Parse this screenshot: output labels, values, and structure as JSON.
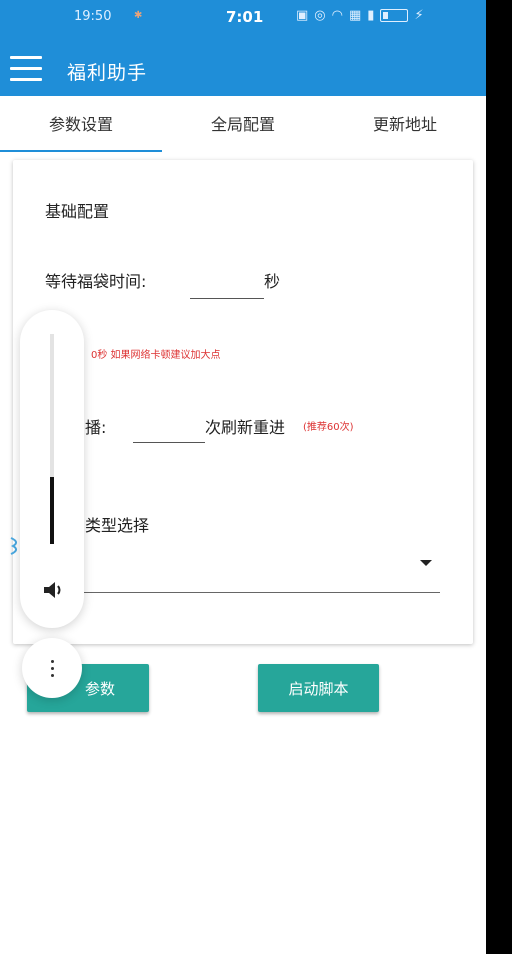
{
  "status_bar": {
    "time_left": "19:50",
    "time_center": "7:01",
    "icons": [
      "hd-icon",
      "message-icon",
      "wifi-icon",
      "signal-icon",
      "battery-icon"
    ]
  },
  "app_bar": {
    "title": "福利助手"
  },
  "tabs": [
    {
      "label": "参数设置",
      "active": true
    },
    {
      "label": "全局配置",
      "active": false
    },
    {
      "label": "更新地址",
      "active": false
    }
  ],
  "form": {
    "section_title": "基础配置",
    "wait_label": "等待福袋时间:",
    "wait_value": "",
    "wait_unit": "秒",
    "wait_note": "0秒 如果网络卡顿建议加大点",
    "retry_label": "播:",
    "retry_value": "",
    "retry_text": "次刷新重进",
    "retry_hint": "(推荐60次)",
    "type_label": "类型选择",
    "type_value": ""
  },
  "buttons": {
    "save": "参数",
    "start": "启动脚本"
  },
  "volume_overlay": {
    "level_fraction": 0.32
  },
  "colors": {
    "primary": "#1f8ed8",
    "accent": "#26a69a",
    "warning": "#dd3333"
  }
}
